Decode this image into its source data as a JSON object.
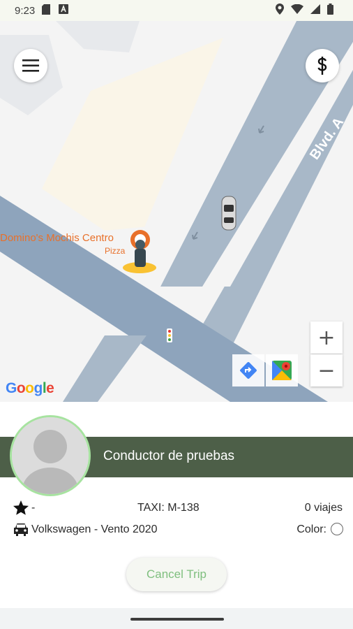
{
  "status_bar": {
    "time": "9:23",
    "left_icons": [
      "sd-card-icon",
      "font-download-icon"
    ],
    "right_icons": [
      "location-icon",
      "wifi-icon",
      "signal-icon",
      "battery-icon"
    ]
  },
  "map": {
    "menu_icon": "hamburger-menu-icon",
    "fare_icon": "dollar-icon",
    "poi_name": "Domino's Mochis Centro",
    "poi_category": "Pizza",
    "street_name": "Blvd. A",
    "zoom_in_label": "+",
    "zoom_out_label": "−",
    "google_letters": [
      "G",
      "o",
      "o",
      "g",
      "l",
      "e"
    ],
    "google_colors": [
      "#4285F4",
      "#EA4335",
      "#FBBC05",
      "#4285F4",
      "#34A853",
      "#EA4335"
    ]
  },
  "driver": {
    "name": "Conductor de pruebas",
    "rating": "-",
    "taxi": "TAXI: M-138",
    "trips": "0 viajes",
    "vehicle": "Volkswagen - Vento 2020",
    "color_label": "Color:"
  },
  "actions": {
    "cancel_label": "Cancel Trip"
  },
  "colors": {
    "driver_bar": "#4d5f48",
    "avatar_ring": "#a7e3a0",
    "cancel_text": "#7fbf7f"
  }
}
